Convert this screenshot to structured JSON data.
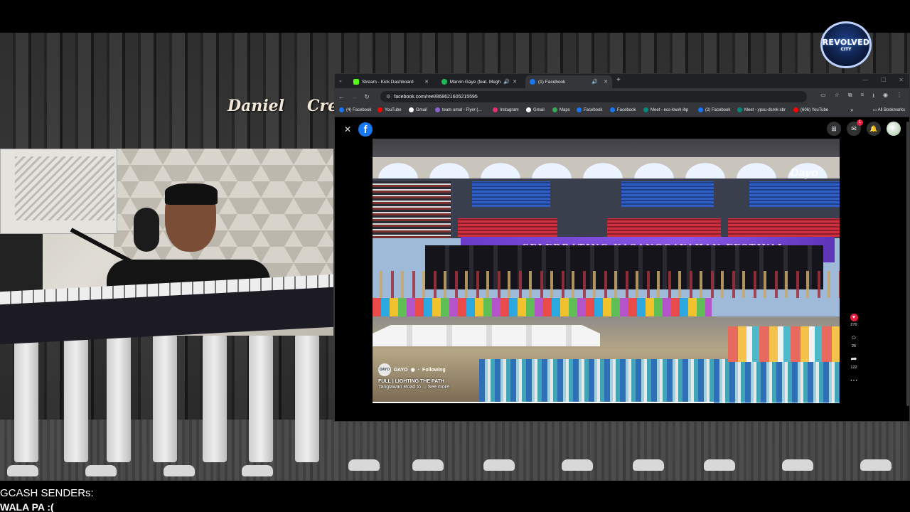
{
  "overlay": {
    "names": [
      "Daniel",
      "Cree"
    ],
    "logo": {
      "line1": "REVOLVED",
      "line2": "CITY"
    },
    "gcash_title": "GCASH SENDERs:",
    "gcash_value": "WALA PA :("
  },
  "browser": {
    "tabs": [
      {
        "label": "Stream - Kick Dashboard",
        "icon": "kick-icon",
        "color": "#53fc18",
        "active": false
      },
      {
        "label": "Marvin Gaye (feat. Meghan",
        "icon": "spotify-icon",
        "color": "#1db954",
        "active": false
      },
      {
        "label": "(1) Facebook",
        "icon": "facebook-icon",
        "color": "#1877f2",
        "active": true
      }
    ],
    "url": "facebook.com/reel/868621605215595",
    "bookmarks": [
      {
        "label": "(4) Facebook",
        "color": "#1877f2"
      },
      {
        "label": "YouTube",
        "color": "#ff0000"
      },
      {
        "label": "Gmail",
        "color": "#ffffff"
      },
      {
        "label": "team umal - Flyer (...",
        "color": "#8a63d2"
      },
      {
        "label": "Instagram",
        "color": "#e1306c"
      },
      {
        "label": "Gmail",
        "color": "#ffffff"
      },
      {
        "label": "Maps",
        "color": "#34a853"
      },
      {
        "label": "Facebook",
        "color": "#1877f2"
      },
      {
        "label": "Facebook",
        "color": "#1877f2"
      },
      {
        "label": "Meet - ecs-kwvk-ihp",
        "color": "#00897b"
      },
      {
        "label": "(2) Facebook",
        "color": "#1877f2"
      },
      {
        "label": "Meet - ypsu-dsmk-sbr",
        "color": "#00897b"
      },
      {
        "label": "(606) YouTube",
        "color": "#ff0000"
      }
    ],
    "all_bookmarks": "All Bookmarks"
  },
  "facebook": {
    "notification_count": "1",
    "reel": {
      "author": "DAYO",
      "author_avatar_text": "DAYO",
      "follow_status": "Following",
      "title": "FULL | LIGHTING THE PATH",
      "caption": "Tanglawan Road to ... See more",
      "banner_text": "CELEBRATING KASANGGAYAHAN FESTIVAL",
      "watermark": "Dayo",
      "progress_fraction": 0.73
    },
    "actions": {
      "likes": "270",
      "comments": "26",
      "shares": "122"
    }
  }
}
